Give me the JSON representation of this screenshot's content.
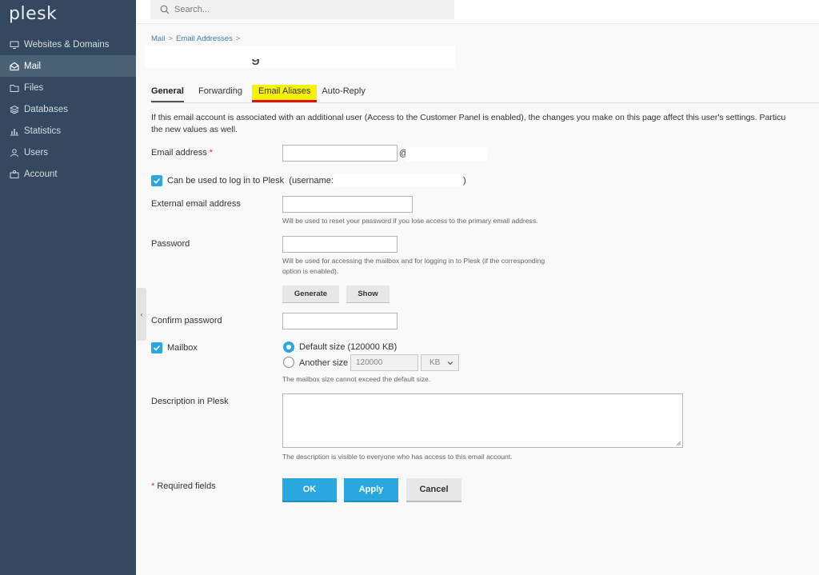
{
  "app": {
    "logo": "plesk"
  },
  "search": {
    "placeholder": "Search..."
  },
  "sidebar": {
    "items": [
      {
        "label": "Websites & Domains",
        "icon": "monitor-icon"
      },
      {
        "label": "Mail",
        "icon": "mail-icon",
        "active": true
      },
      {
        "label": "Files",
        "icon": "folder-icon"
      },
      {
        "label": "Databases",
        "icon": "database-icon"
      },
      {
        "label": "Statistics",
        "icon": "chart-icon"
      },
      {
        "label": "Users",
        "icon": "user-icon"
      },
      {
        "label": "Account",
        "icon": "account-icon"
      }
    ]
  },
  "breadcrumb": {
    "items": [
      "Mail",
      "Email Addresses"
    ],
    "separator": ">"
  },
  "tabs": [
    "General",
    "Forwarding",
    "Email Aliases",
    "Auto-Reply"
  ],
  "note": "If this email account is associated with an additional user (Access to the Customer Panel is enabled), the changes you make on this page affect this user's settings. Particu",
  "note_line2": "the new values as well.",
  "form": {
    "email_label": "Email address",
    "required_mark": "*",
    "at_sign": "@",
    "login_checkbox_label": "Can be used to log in to Plesk",
    "username_prefix": "(username:",
    "username_suffix": ")",
    "external_label": "External email address",
    "external_hint": "Will be used to reset your password if you lose access to the primary email address.",
    "password_label": "Password",
    "password_hint_1": "Will be used for accessing the mailbox and for logging in to Plesk (if the corresponding",
    "password_hint_2": "option is enabled).",
    "generate_label": "Generate",
    "show_label": "Show",
    "confirm_label": "Confirm password",
    "mailbox_label": "Mailbox",
    "default_size_label": "Default size (120000 KB)",
    "another_size_label": "Another size",
    "size_value": "120000",
    "size_unit": "KB",
    "mailbox_hint": "The mailbox size cannot exceed the default size.",
    "description_label": "Description in Plesk",
    "description_hint": "The description is visible to everyone who has access to this email account.",
    "required_fields": "Required fields",
    "ok_label": "OK",
    "apply_label": "Apply",
    "cancel_label": "Cancel"
  },
  "colors": {
    "sidebar": "#34495e",
    "accent": "#29a8e0",
    "highlight": "#f7f300",
    "underline": "#e01010"
  }
}
